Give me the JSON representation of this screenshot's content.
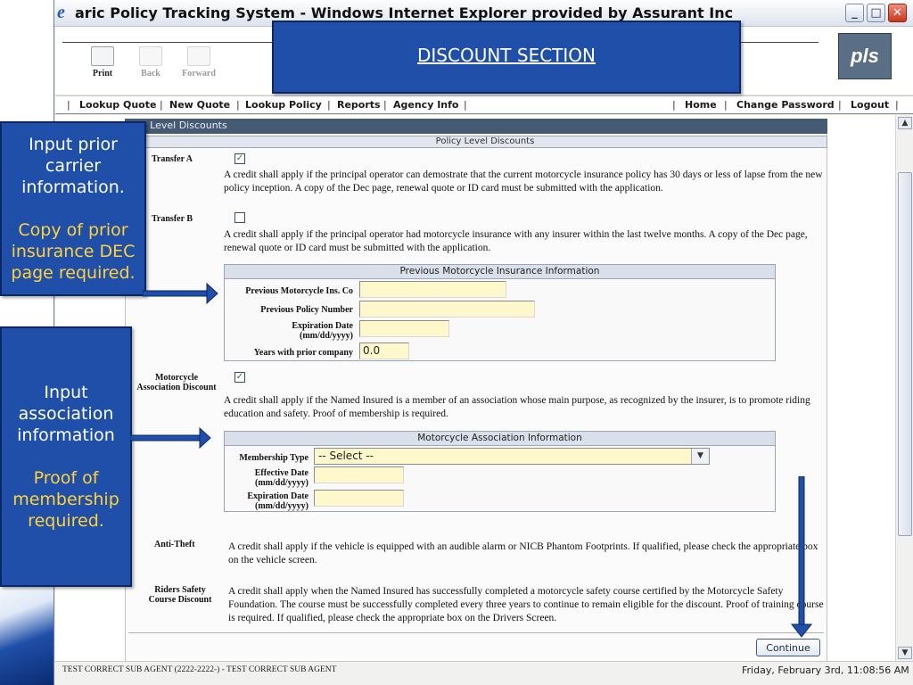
{
  "window": {
    "title": "aric Policy Tracking System - Windows Internet Explorer provided by Assurant Inc",
    "minimize": "_",
    "maximize": "□",
    "close": "✕"
  },
  "toolbar": {
    "print": "Print",
    "back": "Back",
    "forward": "Forward",
    "logo_text": "pls"
  },
  "menu": {
    "items": [
      "Lookup Quote",
      "New Quote",
      "Lookup Policy",
      "Reports",
      "Agency Info"
    ],
    "right_items": [
      "Home",
      "Change Password",
      "Logout"
    ],
    "separator": "|"
  },
  "panel": {
    "title": "licy Level Discounts",
    "subtitle": "Policy Level Discounts"
  },
  "transfer_a": {
    "label": "Transfer A",
    "checked": "✓",
    "text": "A credit shall apply if the principal operator can demostrate that the current motorcycle insurance policy has 30 days or less of lapse from the new policy inception. A copy of the Dec page, renewal quote or ID card must be submitted with the application."
  },
  "transfer_b": {
    "label": "Transfer B",
    "checked": "",
    "text": "A credit shall apply if the principal operator had motorcycle insurance with any insurer within the last twelve months. A copy of the Dec page, renewal quote or ID card must be submitted with the application."
  },
  "prior_insurance": {
    "title": "Previous Motorcycle Insurance Information",
    "company_label": "Previous Motorcycle Ins. Co",
    "company_value": "",
    "policy_label": "Previous Policy Number",
    "policy_value": "",
    "exp_label_1": "Expiration Date",
    "exp_label_2": "(mm/dd/yyyy)",
    "exp_value": "",
    "years_label": "Years with prior company",
    "years_value": "0.0"
  },
  "association": {
    "label_1": "Motorcycle",
    "label_2": "Association Discount",
    "checked": "✓",
    "text": "A credit shall apply if the Named Insured is a member of an association whose main purpose, as recognized by the insurer, is to promote riding education and safety. Proof of membership is required.",
    "box_title": "Motorcycle Association Information",
    "type_label": "Membership Type",
    "type_value": "-- Select --",
    "eff_label_1": "Effective Date",
    "eff_label_2": "(mm/dd/yyyy)",
    "eff_value": "",
    "exp_label_1": "Expiration Date",
    "exp_label_2": "(mm/dd/yyyy)",
    "exp_value": ""
  },
  "anti_theft": {
    "label": "Anti-Theft",
    "text": "A credit shall apply if the vehicle is equipped with an audible alarm or NICB Phantom Footprints. If qualified, please check the appropriate box on the vehicle screen."
  },
  "riders_safety": {
    "label_1": "Riders Safety",
    "label_2": "Course Discount",
    "text": "A credit shall apply when the Named Insured has successfully completed a motorcycle safety course certified by the Motorcycle Safety Foundation. The course must be successfully completed every three years to continue to remain eligible for the discount. Proof of training course is required. If qualified, please check the appropriate box on the Drivers Screen."
  },
  "continue_label": "Continue",
  "status": {
    "left": "TEST CORRECT SUB AGENT (2222-2222-) - TEST CORRECT SUB AGENT",
    "right": "Friday, February 3rd, 11:08:56 AM"
  },
  "callouts": {
    "top": "DISCOUNT SECTION",
    "prior_1": "Input prior carrier information.",
    "prior_2": "Copy of prior insurance DEC page required.",
    "assoc_1": "Input association information",
    "assoc_2": "Proof of membership required."
  },
  "colors": {
    "callout_blue": "#1f4fa8",
    "callout_yellow": "#ffd23a",
    "field_yellow": "#fff8cc",
    "panel_head": "#455a73"
  },
  "icons": {
    "ie": "ie-icon",
    "up_arrow": "▲",
    "down_arrow": "▼",
    "select_arrow": "▼"
  }
}
